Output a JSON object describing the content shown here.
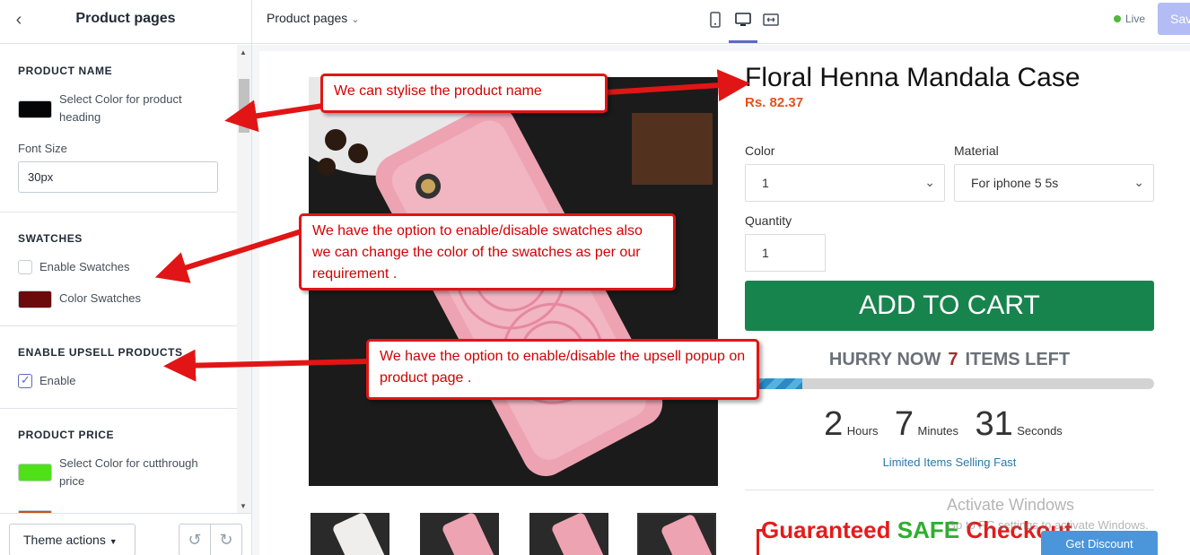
{
  "sidebar": {
    "back_icon": "chevron-left-icon",
    "title": "Product pages",
    "product_name": {
      "heading": "PRODUCT NAME",
      "color_label": "Select Color for product heading",
      "color": "#050505",
      "font_size_label": "Font Size",
      "font_size_value": "30px"
    },
    "swatches": {
      "heading": "SWATCHES",
      "enable_label": "Enable Swatches",
      "enabled": false,
      "color_label": "Color Swatches",
      "color": "#6b0b0b"
    },
    "upsell": {
      "heading": "ENABLE UPSELL PRODUCTS",
      "enable_label": "Enable",
      "enabled": true
    },
    "product_price": {
      "heading": "PRODUCT PRICE",
      "color_label": "Select Color for cutthrough price",
      "color": "#50e01a"
    },
    "footer": {
      "theme_actions": "Theme actions",
      "undo_icon": "undo-icon",
      "redo_icon": "redo-icon"
    }
  },
  "topbar": {
    "page_select": "Product pages",
    "devices": [
      "mobile-icon",
      "desktop-icon",
      "fullscreen-icon"
    ],
    "live_label": "Live",
    "save_label": "Save"
  },
  "product": {
    "title": "Floral Henna Mandala Case",
    "price": "Rs. 82.37",
    "color_label": "Color",
    "color_value": "1",
    "material_label": "Material",
    "material_value": "For iphone 5 5s",
    "quantity_label": "Quantity",
    "quantity_value": "1",
    "add_to_cart": "ADD TO CART",
    "hurry_prefix": "HURRY NOW",
    "items_left": "7",
    "hurry_suffix": "ITEMS LEFT",
    "stock_fraction": 0.14,
    "timer": {
      "hours": "2",
      "hours_label": "Hours",
      "minutes": "7",
      "minutes_label": "Minutes",
      "seconds": "31",
      "seconds_label": "Seconds"
    },
    "limited_text": "Limited Items Selling Fast",
    "guarantee_a": "Guaranteed",
    "guarantee_b": "SAFE",
    "guarantee_c": "Checkout",
    "get_discount": "Get Discount"
  },
  "annotations": {
    "name_note": "We can stylise the product name",
    "swatch_note": "We have the option to enable/disable swatches also we can change the color of the swatches as per our requirement .",
    "upsell_note": "We have the option to enable/disable the upsell popup on product page ."
  },
  "watermark": {
    "title": "Activate Windows",
    "subtitle": "Go to PC settings to activate Windows."
  },
  "colors": {
    "accent": "#5c6ac4",
    "add_to_cart": "#17844e",
    "annotation": "#e11515"
  }
}
